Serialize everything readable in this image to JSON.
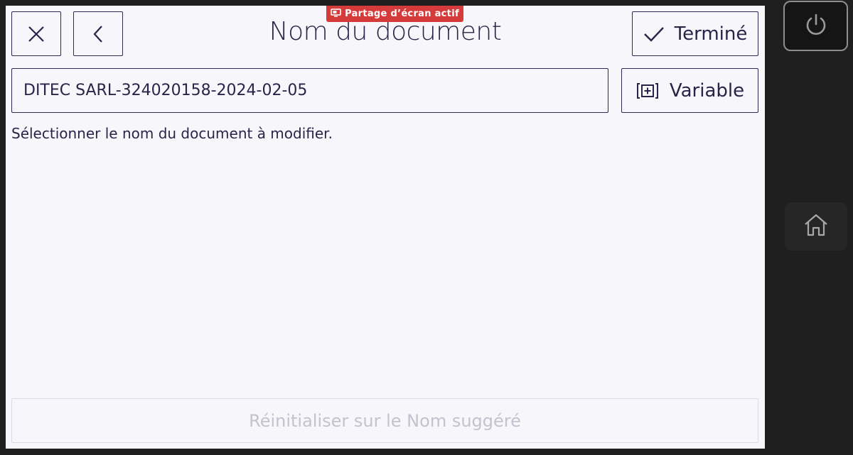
{
  "header": {
    "title": "Nom du document",
    "close_icon": "close-icon",
    "back_icon": "chevron-left-icon",
    "done_label": "Terminé",
    "done_icon": "checkmark-icon"
  },
  "banner": {
    "label": "Partage d’écran actif",
    "icon": "screen-share-icon",
    "color": "#d63b3b"
  },
  "document_name": {
    "value": "DITEC SARL-324020158-2024-02-05"
  },
  "variable_button": {
    "label": "Variable",
    "icon": "add-variable-icon"
  },
  "hint": "Sélectionner le nom du document à modifier.",
  "reset_button": {
    "label": "Réinitialiser sur le Nom suggéré",
    "disabled": true
  },
  "side_panel": {
    "power_icon": "power-icon",
    "home_icon": "home-icon"
  },
  "colors": {
    "screen_bg": "#f7f6fb",
    "text": "#2a2448",
    "border": "#2f2a4e",
    "disabled_text": "#c4c2cf",
    "bezel": "#1f1f1f"
  }
}
